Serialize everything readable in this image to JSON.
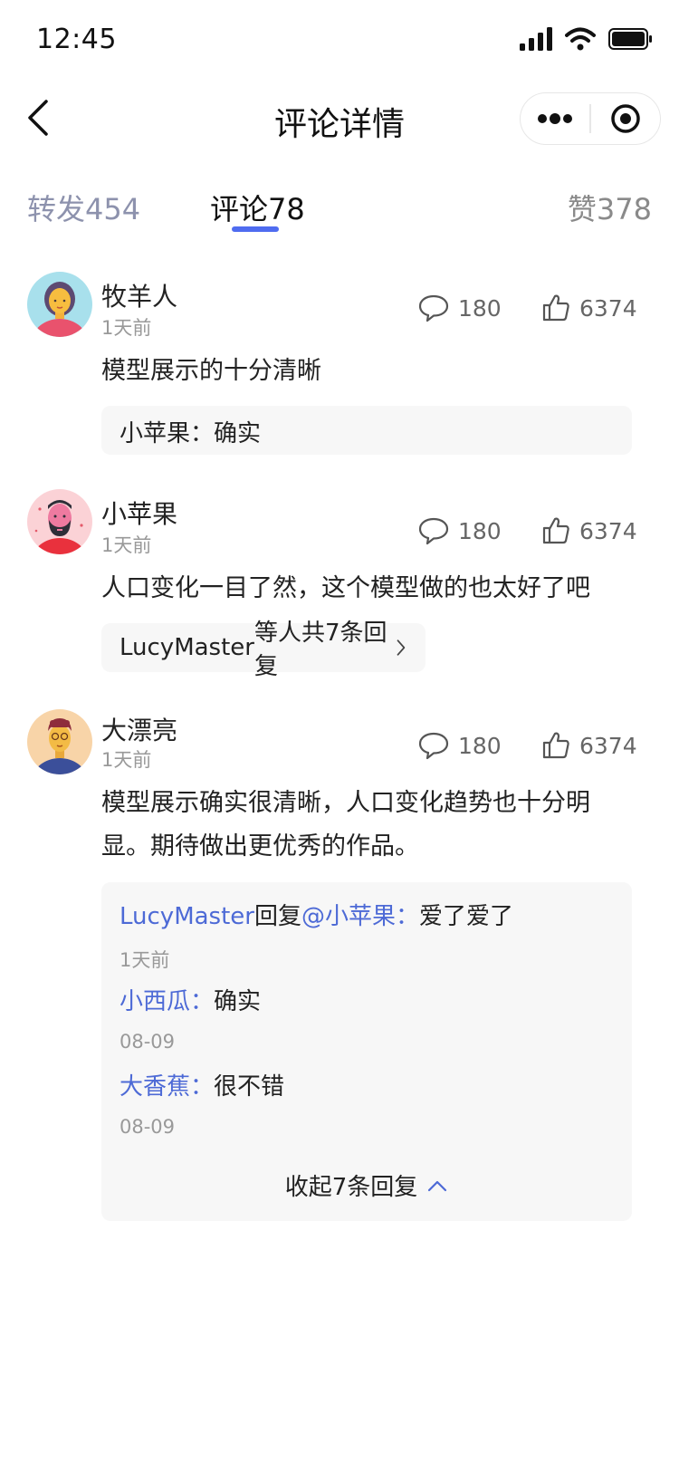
{
  "status": {
    "time": "12:45"
  },
  "nav": {
    "title": "评论详情"
  },
  "tabs": {
    "repost": "转发454",
    "comment": "评论78",
    "like": "赞378"
  },
  "comments": [
    {
      "name": "牧羊人",
      "time": "1天前",
      "reply_count": "180",
      "like_count": "6374",
      "text": "模型展示的十分清晰",
      "reply_preview": {
        "user": "小苹果：",
        "text": "确实"
      }
    },
    {
      "name": "小苹果",
      "time": "1天前",
      "reply_count": "180",
      "like_count": "6374",
      "text": "人口变化一目了然，这个模型做的也太好了吧",
      "reply_summary": {
        "user": "LucyMaster",
        "text": "等人共7条回复"
      }
    },
    {
      "name": "大漂亮",
      "time": "1天前",
      "reply_count": "180",
      "like_count": "6374",
      "text_line1": "模型展示确实很清晰，人口变化趋势也十分明",
      "text_line2": "显。期待做出更优秀的作品。",
      "replies": [
        {
          "user": "LucyMaster",
          "action": "回复",
          "mention": "@小苹果：",
          "text": "爱了爱了",
          "date": "1天前"
        },
        {
          "user": "小西瓜：",
          "text": "确实",
          "date": "08-09"
        },
        {
          "user": "大香蕉：",
          "text": "很不错",
          "date": "08-09"
        }
      ],
      "collapse_label": "收起7条回复"
    }
  ],
  "colors": {
    "accent": "#4f6cf0",
    "link": "#4d6ad6"
  }
}
